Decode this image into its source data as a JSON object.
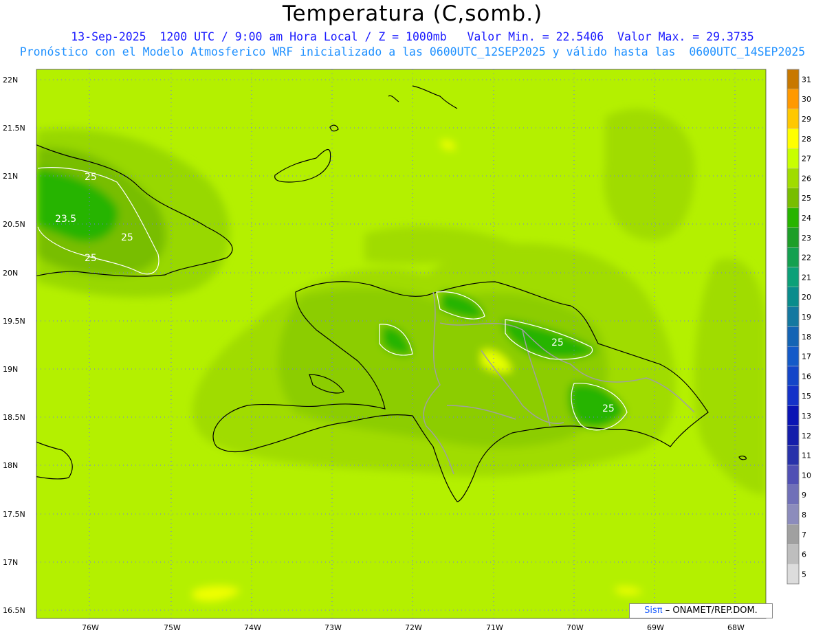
{
  "header": {
    "title": "Temperatura (C,somb.)",
    "line1": "13-Sep-2025  1200 UTC / 9:00 am Hora Local / Z = 1000mb   Valor Min. = 22.5406  Valor Max. = 29.3735",
    "line2": "Pronóstico con el Modelo Atmosferico WRF inicializado a las 0600UTC_12SEP2025 y válido hasta las  0600UTC_14SEP2025"
  },
  "axes": {
    "lat_labels": [
      "22N",
      "21.5N",
      "21N",
      "20.5N",
      "20N",
      "19.5N",
      "19N",
      "18.5N",
      "18N",
      "17.5N",
      "17N",
      "16.5N"
    ],
    "lon_labels": [
      "76W",
      "75W",
      "74W",
      "73W",
      "72W",
      "71W",
      "70W",
      "69W",
      "68W"
    ]
  },
  "legend": {
    "levels": [
      "31",
      "30",
      "29",
      "28",
      "27",
      "26",
      "25",
      "24",
      "23",
      "22",
      "21",
      "20",
      "19",
      "18",
      "17",
      "16",
      "15",
      "13",
      "12",
      "11",
      "10",
      "9",
      "8",
      "7",
      "6",
      "5"
    ],
    "colors": [
      "#c87800",
      "#ff9900",
      "#ffc800",
      "#ffff00",
      "#c8ff00",
      "#a0dc00",
      "#78be00",
      "#28b400",
      "#1e9e28",
      "#14a050",
      "#0ca078",
      "#0a8c8c",
      "#1478a0",
      "#1464b4",
      "#145ac8",
      "#1446c8",
      "#1432c8",
      "#0a14b4",
      "#141eaa",
      "#2832aa",
      "#5050b4",
      "#7070b8",
      "#8c8cbc",
      "#a0a0a0",
      "#bebebe",
      "#dcdcdc"
    ]
  },
  "contour_labels": [
    "25",
    "23.5",
    "25",
    "25",
    "25",
    "25",
    "25"
  ],
  "credit": {
    "brand": "Sisπ",
    "text": "– ONAMET/REP.DOM."
  }
}
